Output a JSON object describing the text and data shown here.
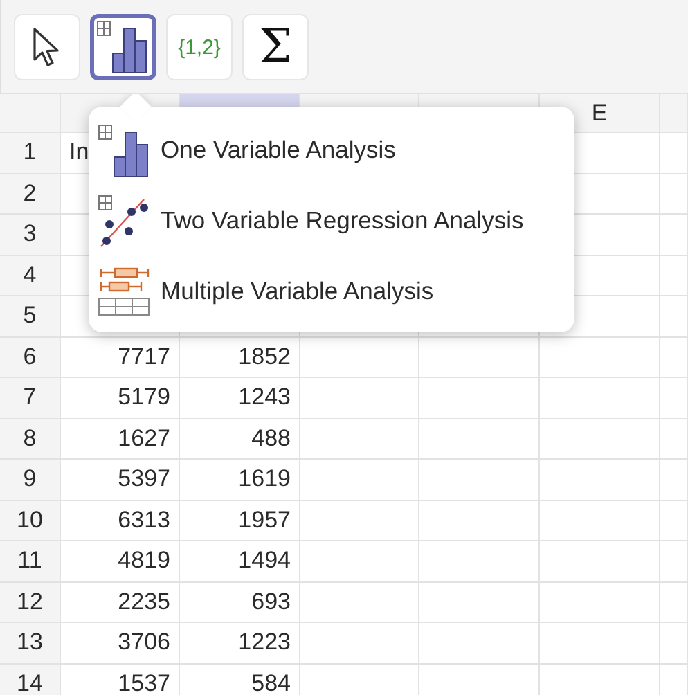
{
  "toolbar": [
    {
      "kind": "move",
      "selected": false
    },
    {
      "kind": "one-variable",
      "selected": true
    },
    {
      "kind": "list",
      "text": "{1,2}",
      "selected": false
    },
    {
      "kind": "sum",
      "text": "Σ",
      "selected": false
    }
  ],
  "columns": [
    {
      "selected": false
    },
    {
      "selected": true
    },
    {
      "selected": false
    },
    {
      "selected": false
    },
    {
      "label": "E",
      "selected": false
    },
    {
      "selected": false
    }
  ],
  "rows": [
    {
      "num": "1",
      "a": "In"
    },
    {
      "num": "2"
    },
    {
      "num": "3"
    },
    {
      "num": "4"
    },
    {
      "num": "5"
    },
    {
      "num": "6",
      "a": "7717",
      "b": "1852"
    },
    {
      "num": "7",
      "a": "5179",
      "b": "1243"
    },
    {
      "num": "8",
      "a": "1627",
      "b": "488"
    },
    {
      "num": "9",
      "a": "5397",
      "b": "1619"
    },
    {
      "num": "10",
      "a": "6313",
      "b": "1957"
    },
    {
      "num": "11",
      "a": "4819",
      "b": "1494"
    },
    {
      "num": "12",
      "a": "2235",
      "b": "693"
    },
    {
      "num": "13",
      "a": "3706",
      "b": "1223"
    },
    {
      "num": "14",
      "a": "1537",
      "b": "584"
    }
  ],
  "menu": [
    {
      "kind": "one-variable",
      "label": "One Variable Analysis"
    },
    {
      "kind": "two-variable",
      "label": "Two Variable Regression Analysis"
    },
    {
      "kind": "multiple-variable",
      "label": "Multiple Variable Analysis"
    }
  ]
}
